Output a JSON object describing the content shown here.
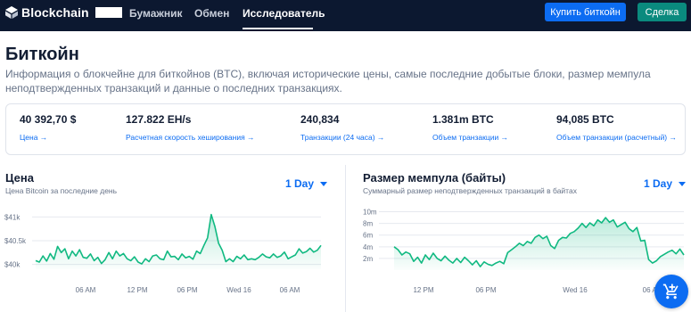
{
  "nav": {
    "logo": "Blockchain",
    "items": [
      {
        "label": "Бумажник"
      },
      {
        "label": "Обмен"
      },
      {
        "label": "Исследователь",
        "active": true
      }
    ],
    "buy_label": "Купить биткойн",
    "trade_label": "Сделка"
  },
  "page": {
    "title": "Биткойн",
    "description": "Информация о блокчейне для биткойнов (BTC), включая исторические цены, самые последние добытые блоки, размер мемпула неподтвержденных транзакций и данные о последних транзакциях."
  },
  "stats": [
    {
      "value": "40 392,70 $",
      "link": "Цена →"
    },
    {
      "value": "127.822 EH/s",
      "link": "Расчетная скорость хеширования →"
    },
    {
      "value": "240,834",
      "link": "Транзакции (24 часа) →"
    },
    {
      "value": "1.381m BTC",
      "link": "Объем транзакции →"
    },
    {
      "value": "94,085 BTC",
      "link": "Объем транзакции (расчетный) →"
    }
  ],
  "price_panel": {
    "title": "Цена",
    "subtitle": "Цена Bitcoin за последние день",
    "range": "1 Day"
  },
  "mempool_panel": {
    "title": "Размер мемпула (байты)",
    "subtitle": "Суммарный размер неподтвержденных транзакций в байтах",
    "range": "1 Day"
  },
  "colors": {
    "nav_bg": "#0c1830",
    "accent": "#0c6cf2",
    "trade": "#0a8a7e",
    "chart_line": "#10b981"
  },
  "chart_data": [
    {
      "type": "area",
      "title": "Цена",
      "y_ticks": [
        "$40k",
        "$40.5k",
        "$41k"
      ],
      "y_tick_values": [
        40000,
        40500,
        41000
      ],
      "x_ticks": [
        "06 AM",
        "12 PM",
        "06 PM",
        "Wed 16",
        "06 AM"
      ],
      "ylim": [
        39900,
        41100
      ],
      "series": [
        {
          "values": [
            40080,
            40050,
            40180,
            40070,
            40230,
            40110,
            40380,
            40250,
            40330,
            40120,
            40280,
            40180,
            40310,
            40150,
            40130,
            40220,
            40080,
            40150,
            40020,
            40100,
            40250,
            40120,
            40280,
            40180,
            40230,
            40120,
            40080,
            40160,
            40050,
            40010,
            40120,
            40060,
            40180,
            40200,
            40120,
            40100,
            40280,
            40160,
            40170,
            40100,
            40220,
            40140,
            40170,
            40110,
            40280,
            40230,
            40400,
            40560,
            41050,
            40800,
            40450,
            40300,
            40060,
            40120,
            40060,
            40170,
            40120,
            40200,
            40100,
            40120,
            40100,
            40150,
            40220,
            40160,
            40140,
            40220,
            40150,
            40180,
            40260,
            40120,
            40160,
            40200,
            40330,
            40240,
            40270,
            40340,
            40260,
            40300,
            40400
          ]
        }
      ]
    },
    {
      "type": "area",
      "title": "Размер мемпула (байты)",
      "y_ticks": [
        "2m",
        "4m",
        "6m",
        "8m",
        "10m"
      ],
      "y_tick_values": [
        2,
        4,
        6,
        8,
        10
      ],
      "x_ticks": [
        "12 PM",
        "06 PM",
        "Wed 16",
        "06 AM"
      ],
      "ylim": [
        0,
        11
      ],
      "series": [
        {
          "values": [
            4.0,
            3.5,
            2.6,
            3.1,
            2.8,
            1.5,
            2.2,
            1.2,
            2.6,
            1.8,
            2.9,
            2.0,
            1.6,
            2.4,
            1.7,
            1.2,
            2.0,
            1.3,
            2.2,
            1.6,
            0.9,
            1.6,
            0.6,
            1.4,
            1.0,
            0.8,
            1.2,
            1.5,
            1.1,
            3.0,
            3.5,
            4.0,
            4.6,
            4.2,
            4.9,
            4.6,
            5.6,
            6.0,
            5.4,
            5.8,
            4.2,
            3.7,
            5.1,
            5.6,
            5.5,
            6.3,
            6.6,
            7.2,
            8.0,
            7.3,
            8.1,
            7.6,
            8.6,
            8.1,
            9.0,
            8.2,
            8.6,
            7.4,
            7.8,
            8.2,
            7.1,
            6.6,
            7.3,
            5.0,
            5.1,
            1.8,
            1.2,
            1.6,
            2.3,
            2.7,
            3.1,
            3.4,
            2.8,
            3.6,
            2.6
          ]
        }
      ]
    }
  ]
}
